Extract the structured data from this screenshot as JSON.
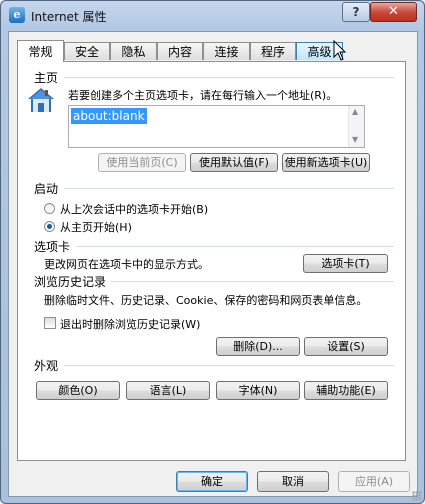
{
  "window": {
    "title": "Internet 属性",
    "help_label": "?",
    "close_label": "✕",
    "icon": "internet-options-icon"
  },
  "tabs": [
    {
      "label": "常规",
      "active": true
    },
    {
      "label": "安全"
    },
    {
      "label": "隐私"
    },
    {
      "label": "内容"
    },
    {
      "label": "连接"
    },
    {
      "label": "程序"
    },
    {
      "label": "高级",
      "hovered": true
    }
  ],
  "home": {
    "section": "主页",
    "description": "若要创建多个主页选项卡，请在每行输入一个地址(R)。",
    "value": "about:blank",
    "use_current_label": "使用当前页(C)",
    "use_default_label": "使用默认值(F)",
    "use_new_tab_label": "使用新选项卡(U)",
    "icon": "home-icon"
  },
  "startup": {
    "section": "启动",
    "option_last_session": "从上次会话中的选项卡开始(B)",
    "option_home_page": "从主页开始(H)",
    "selected": "option_home_page"
  },
  "tabs_settings": {
    "section": "选项卡",
    "description": "更改网页在选项卡中的显示方式。",
    "button_label": "选项卡(T)"
  },
  "history": {
    "section": "浏览历史记录",
    "description": "删除临时文件、历史记录、Cookie、保存的密码和网页表单信息。",
    "checkbox_label": "退出时删除浏览历史记录(W)",
    "checked": false,
    "delete_label": "删除(D)...",
    "settings_label": "设置(S)"
  },
  "appearance": {
    "section": "外观",
    "colors_label": "颜色(O)",
    "languages_label": "语言(L)",
    "fonts_label": "字体(N)",
    "accessibility_label": "辅助功能(E)"
  },
  "footer": {
    "ok_label": "确定",
    "cancel_label": "取消",
    "apply_label": "应用(A)"
  },
  "colors": {
    "accent": "#3399ff",
    "title_bar": "#b2c8e4",
    "close_button": "#c9493a"
  }
}
